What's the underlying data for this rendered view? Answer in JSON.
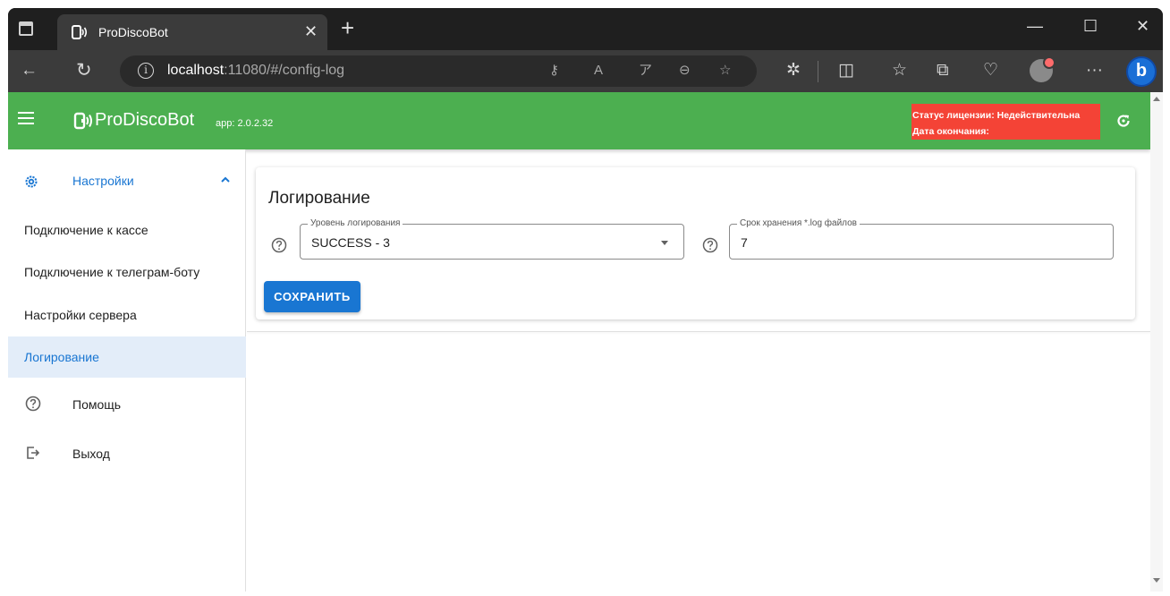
{
  "browser": {
    "tab_title": "ProDiscoBot",
    "tab_close": "✕",
    "new_tab": "+",
    "url_host": "localhost",
    "url_rest": ":11080/#/config-log",
    "window_controls": [
      "—",
      "☐",
      "✕"
    ],
    "toolbar_icons": [
      "back-icon",
      "refresh-icon",
      "info-icon",
      "key-icon",
      "read-aloud-icon",
      "translate-icon",
      "zoom-out-icon",
      "favorite-star-icon",
      "extensions-icon",
      "split-screen-icon",
      "favorites-icon",
      "collections-icon",
      "browser-essentials-icon",
      "profile-avatar",
      "more-icon",
      "bing-copilot-icon"
    ]
  },
  "app": {
    "brand": "ProDiscoBot",
    "version": "app: 2.0.2.32",
    "license_status": "Статус лицензии: Недействительна",
    "license_expiry": "Дата окончания:",
    "colors": {
      "appbar": "#4caf50",
      "license_badge": "#f44336",
      "primary": "#1976d2",
      "active_nav": "#e3edf9"
    }
  },
  "sidebar": {
    "group_label": "Настройки",
    "items": [
      {
        "label": "Подключение к кассе",
        "active": false
      },
      {
        "label": "Подключение к телеграм-боту",
        "active": false
      },
      {
        "label": "Настройки сервера",
        "active": false
      },
      {
        "label": "Логирование",
        "active": true
      }
    ],
    "help": "Помощь",
    "logout": "Выход"
  },
  "main": {
    "title": "Логирование",
    "log_level": {
      "label": "Уровень логирования",
      "value": "SUCCESS - 3"
    },
    "retention": {
      "label": "Срок хранения *.log файлов",
      "value": "7"
    },
    "save_label": "СОХРАНИТЬ"
  }
}
